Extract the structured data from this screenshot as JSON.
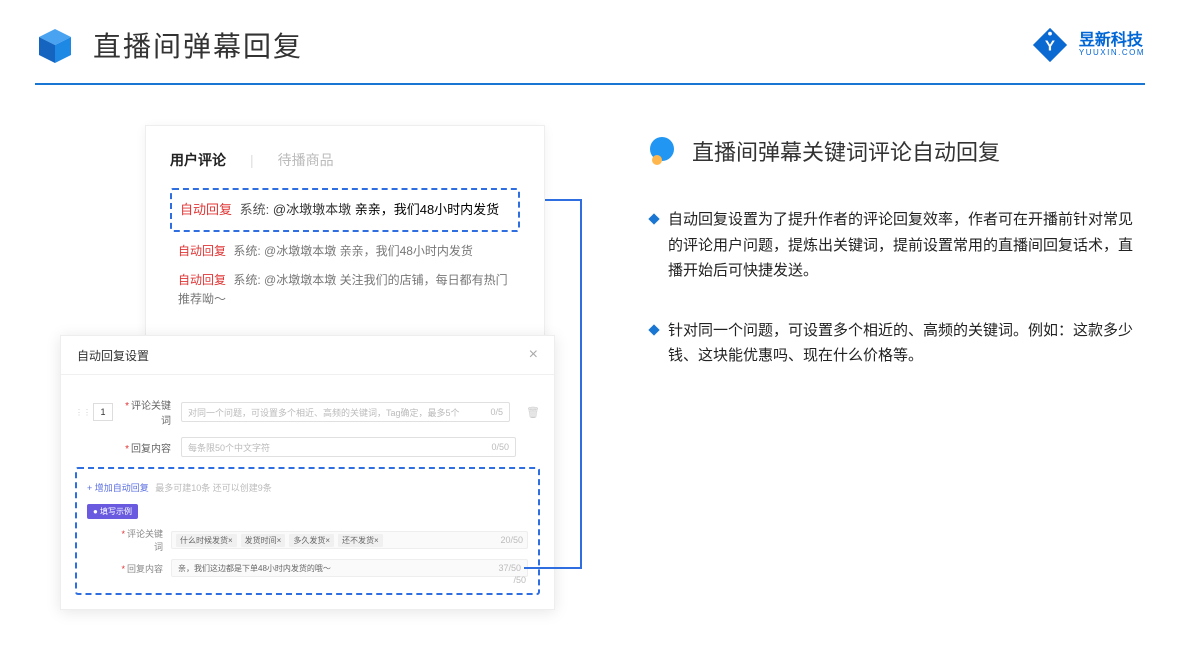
{
  "header": {
    "title": "直播间弹幕回复",
    "brand_name": "昱新科技",
    "brand_sub": "YUUXIN.COM"
  },
  "right": {
    "section_title": "直播间弹幕关键词评论自动回复",
    "bullets": [
      "自动回复设置为了提升作者的评论回复效率，作者可在开播前针对常见的评论用户问题，提炼出关键词，提前设置常用的直播间回复话术，直播开始后可快捷发送。",
      "针对同一个问题，可设置多个相近的、高频的关键词。例如：这款多少钱、这块能优惠吗、现在什么价格等。"
    ]
  },
  "topcard": {
    "tab_active": "用户评论",
    "tab_inactive": "待播商品",
    "reply_tag": "自动回复",
    "sys_tag": "系统:",
    "at_user": "@冰墩墩本墩",
    "msg1_tail": " 亲亲，我们48小时内发货",
    "msg2_tail": " 亲亲，我们48小时内发货",
    "msg3_tail": " 关注我们的店铺，每日都有热门推荐呦～"
  },
  "bottomcard": {
    "title": "自动回复设置",
    "num": "1",
    "label_keyword": "评论关键词",
    "placeholder_kw": "对同一个问题，可设置多个相近、高频的关键词，Tag确定，最多5个",
    "counter_kw": "0/5",
    "label_content": "回复内容",
    "placeholder_ct": "每条限50个中文字符",
    "counter_ct": "0/50",
    "add_link": "+ 增加自动回复",
    "add_note": "最多可建10条 还可以创建9条",
    "btn_example": "● 填写示例",
    "tags": [
      "什么时候发货×",
      "发货时间×",
      "多久发货×",
      "还不发货×"
    ],
    "ex_counter_kw": "20/50",
    "ex_content": "亲，我们这边都是下单48小时内发货的哦～",
    "ex_counter_ct": "37/50",
    "orphan": "/50"
  }
}
